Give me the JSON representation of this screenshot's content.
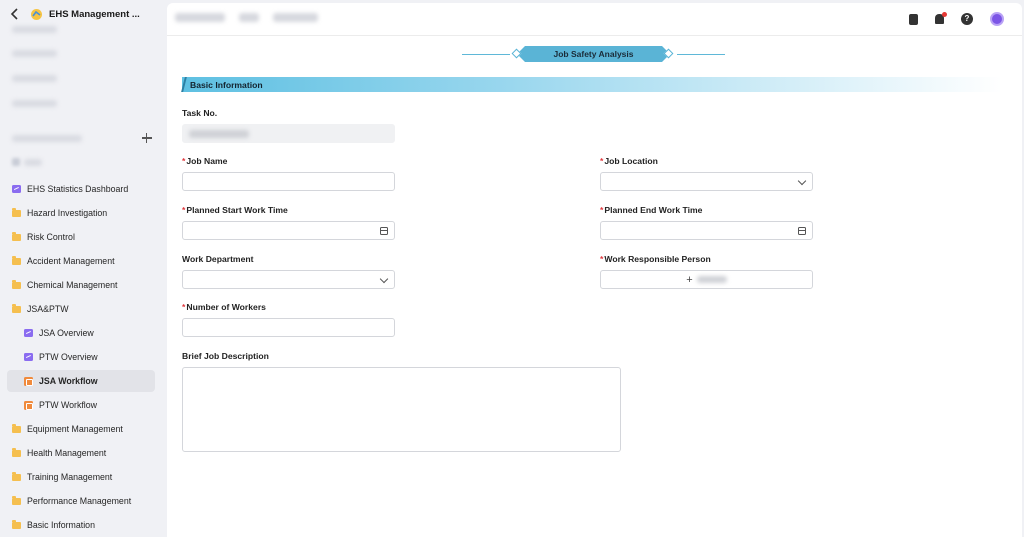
{
  "app": {
    "title": "EHS Management ..."
  },
  "sidebar": {
    "items": [
      {
        "label": "EHS Statistics Dashboard",
        "icon": "chart-icon"
      },
      {
        "label": "Hazard Investigation",
        "icon": "folder-icon"
      },
      {
        "label": "Risk Control",
        "icon": "folder-icon"
      },
      {
        "label": "Accident Management",
        "icon": "folder-icon"
      },
      {
        "label": "Chemical Management",
        "icon": "folder-icon"
      },
      {
        "label": "JSA&PTW",
        "icon": "folder-icon"
      },
      {
        "label": "JSA Overview",
        "icon": "chart-icon"
      },
      {
        "label": "PTW Overview",
        "icon": "chart-icon"
      },
      {
        "label": "JSA Workflow",
        "icon": "flow-icon"
      },
      {
        "label": "PTW Workflow",
        "icon": "flow-icon"
      },
      {
        "label": "Equipment Management",
        "icon": "folder-icon"
      },
      {
        "label": "Health Management",
        "icon": "folder-icon"
      },
      {
        "label": "Training Management",
        "icon": "folder-icon"
      },
      {
        "label": "Performance Management",
        "icon": "folder-icon"
      },
      {
        "label": "Basic Information",
        "icon": "folder-icon"
      }
    ]
  },
  "form": {
    "title": "Job Safety Analysis",
    "section": "Basic Information",
    "task_no_label": "Task No.",
    "job_name_label": "Job Name",
    "job_location_label": "Job Location",
    "planned_start_label": "Planned Start Work Time",
    "planned_end_label": "Planned End Work Time",
    "work_department_label": "Work Department",
    "responsible_person_label": "Work Responsible Person",
    "number_of_workers_label": "Number of Workers",
    "brief_description_label": "Brief Job Description",
    "required_mark": "*",
    "add_person_symbol": "+"
  },
  "colors": {
    "accent": "#5ab4d6",
    "required": "#e0393e",
    "active_nav": "#e2e3e8",
    "avatar": "#7c55e6"
  }
}
